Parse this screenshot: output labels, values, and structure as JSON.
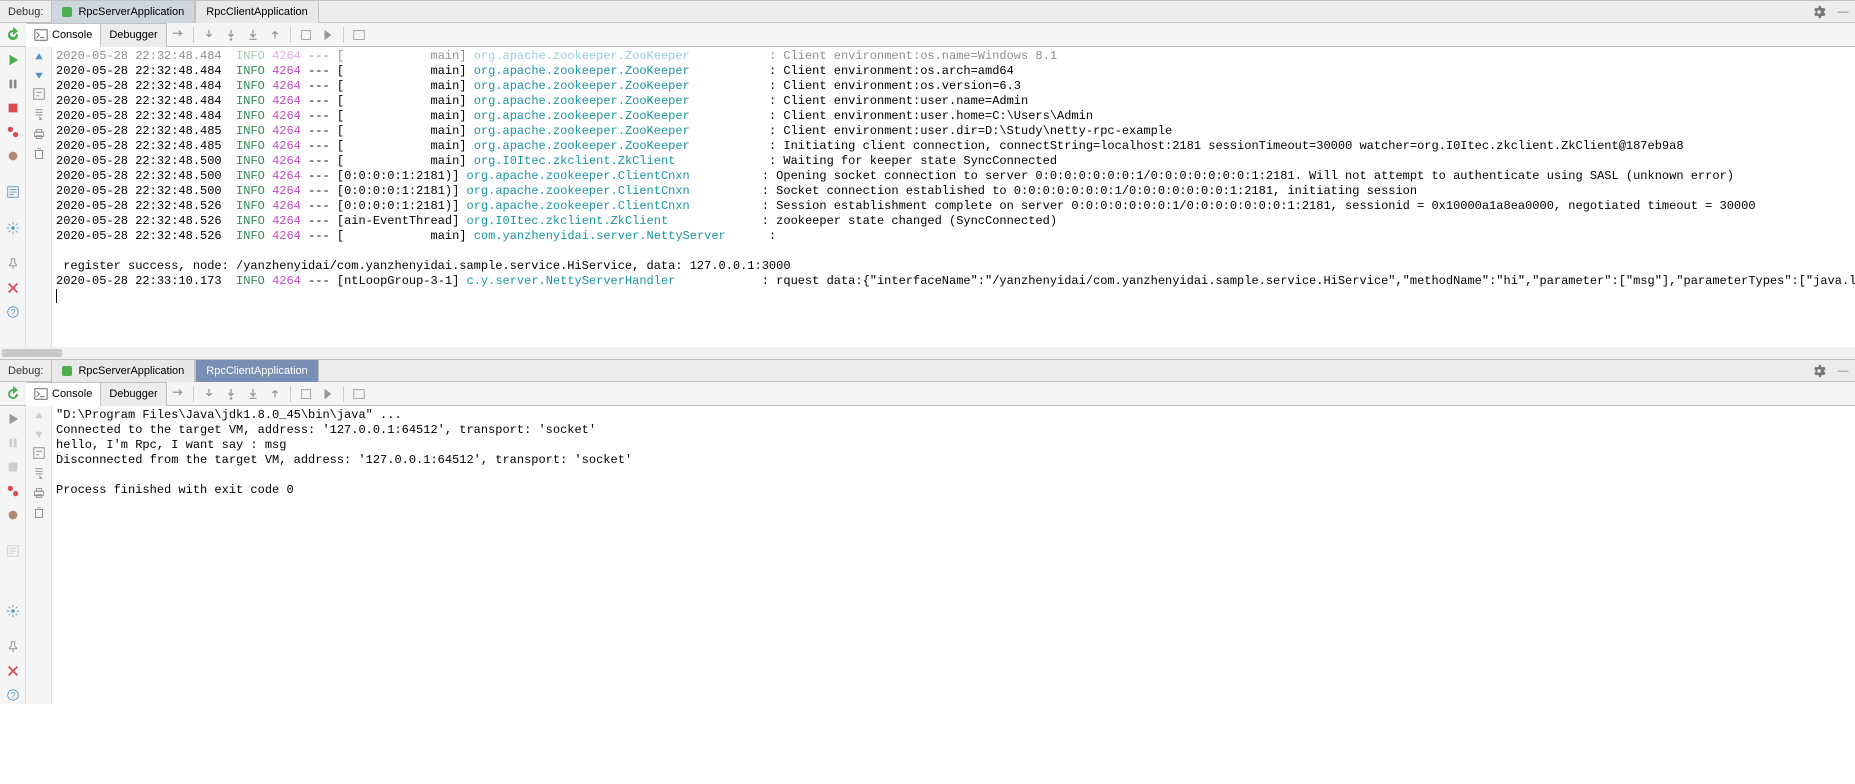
{
  "panel1": {
    "debug_label": "Debug:",
    "tabs": [
      {
        "label": "RpcServerApplication",
        "active": true
      },
      {
        "label": "RpcClientApplication",
        "active": false
      }
    ],
    "subtabs": {
      "console": "Console",
      "debugger": "Debugger"
    },
    "log_lines": [
      {
        "ts": "2020-05-28 22:32:48.484",
        "lvl": "INFO",
        "pid": "4264",
        "thread": "[            main]",
        "logger": "org.apache.zookeeper.ZooKeeper",
        "msg": ": Client environment:os.name=Windows 8.1",
        "faded": true
      },
      {
        "ts": "2020-05-28 22:32:48.484",
        "lvl": "INFO",
        "pid": "4264",
        "thread": "[            main]",
        "logger": "org.apache.zookeeper.ZooKeeper",
        "msg": ": Client environment:os.arch=amd64"
      },
      {
        "ts": "2020-05-28 22:32:48.484",
        "lvl": "INFO",
        "pid": "4264",
        "thread": "[            main]",
        "logger": "org.apache.zookeeper.ZooKeeper",
        "msg": ": Client environment:os.version=6.3"
      },
      {
        "ts": "2020-05-28 22:32:48.484",
        "lvl": "INFO",
        "pid": "4264",
        "thread": "[            main]",
        "logger": "org.apache.zookeeper.ZooKeeper",
        "msg": ": Client environment:user.name=Admin"
      },
      {
        "ts": "2020-05-28 22:32:48.484",
        "lvl": "INFO",
        "pid": "4264",
        "thread": "[            main]",
        "logger": "org.apache.zookeeper.ZooKeeper",
        "msg": ": Client environment:user.home=C:\\Users\\Admin"
      },
      {
        "ts": "2020-05-28 22:32:48.485",
        "lvl": "INFO",
        "pid": "4264",
        "thread": "[            main]",
        "logger": "org.apache.zookeeper.ZooKeeper",
        "msg": ": Client environment:user.dir=D:\\Study\\netty-rpc-example"
      },
      {
        "ts": "2020-05-28 22:32:48.485",
        "lvl": "INFO",
        "pid": "4264",
        "thread": "[            main]",
        "logger": "org.apache.zookeeper.ZooKeeper",
        "msg": ": Initiating client connection, connectString=localhost:2181 sessionTimeout=30000 watcher=org.I0Itec.zkclient.ZkClient@187eb9a8"
      },
      {
        "ts": "2020-05-28 22:32:48.500",
        "lvl": "INFO",
        "pid": "4264",
        "thread": "[            main]",
        "logger": "org.I0Itec.zkclient.ZkClient",
        "msg": ": Waiting for keeper state SyncConnected"
      },
      {
        "ts": "2020-05-28 22:32:48.500",
        "lvl": "INFO",
        "pid": "4264",
        "thread": "[0:0:0:0:1:2181)]",
        "logger": "org.apache.zookeeper.ClientCnxn",
        "msg": ": Opening socket connection to server 0:0:0:0:0:0:0:1/0:0:0:0:0:0:0:1:2181. Will not attempt to authenticate using SASL (unknown error)"
      },
      {
        "ts": "2020-05-28 22:32:48.500",
        "lvl": "INFO",
        "pid": "4264",
        "thread": "[0:0:0:0:1:2181)]",
        "logger": "org.apache.zookeeper.ClientCnxn",
        "msg": ": Socket connection established to 0:0:0:0:0:0:0:1/0:0:0:0:0:0:0:1:2181, initiating session"
      },
      {
        "ts": "2020-05-28 22:32:48.526",
        "lvl": "INFO",
        "pid": "4264",
        "thread": "[0:0:0:0:1:2181)]",
        "logger": "org.apache.zookeeper.ClientCnxn",
        "msg": ": Session establishment complete on server 0:0:0:0:0:0:0:1/0:0:0:0:0:0:0:1:2181, sessionid = 0x10000a1a8ea0000, negotiated timeout = 30000"
      },
      {
        "ts": "2020-05-28 22:32:48.526",
        "lvl": "INFO",
        "pid": "4264",
        "thread": "[ain-EventThread]",
        "logger": "org.I0Itec.zkclient.ZkClient",
        "msg": ": zookeeper state changed (SyncConnected)"
      },
      {
        "ts": "2020-05-28 22:32:48.526",
        "lvl": "INFO",
        "pid": "4264",
        "thread": "[            main]",
        "logger": "com.yanzhenyidai.server.NettyServer",
        "msg": ": "
      }
    ],
    "extra_lines": [
      " register success, node: /yanzhenyidai/com.yanzhenyidai.sample.service.HiService, data: 127.0.0.1:3000"
    ],
    "last_log": {
      "ts": "2020-05-28 22:33:10.173",
      "lvl": "INFO",
      "pid": "4264",
      "thread": "[ntLoopGroup-3-1]",
      "logger": "c.y.server.NettyServerHandler",
      "msg": ": rquest data:{\"interfaceName\":\"/yanzhenyidai/com.yanzhenyidai.sample.service.HiService\",\"methodName\":\"hi\",\"parameter\":[\"msg\"],\"parameterTypes\":[\"java.lang.S"
    }
  },
  "panel2": {
    "debug_label": "Debug:",
    "tabs": [
      {
        "label": "RpcServerApplication",
        "active": false
      },
      {
        "label": "RpcClientApplication",
        "active": true
      }
    ],
    "subtabs": {
      "console": "Console",
      "debugger": "Debugger"
    },
    "lines": [
      "\"D:\\Program Files\\Java\\jdk1.8.0_45\\bin\\java\" ...",
      "Connected to the target VM, address: '127.0.0.1:64512', transport: 'socket'",
      "hello, I'm Rpc, I want say : msg",
      "Disconnected from the target VM, address: '127.0.0.1:64512', transport: 'socket'",
      "",
      "Process finished with exit code 0"
    ]
  }
}
